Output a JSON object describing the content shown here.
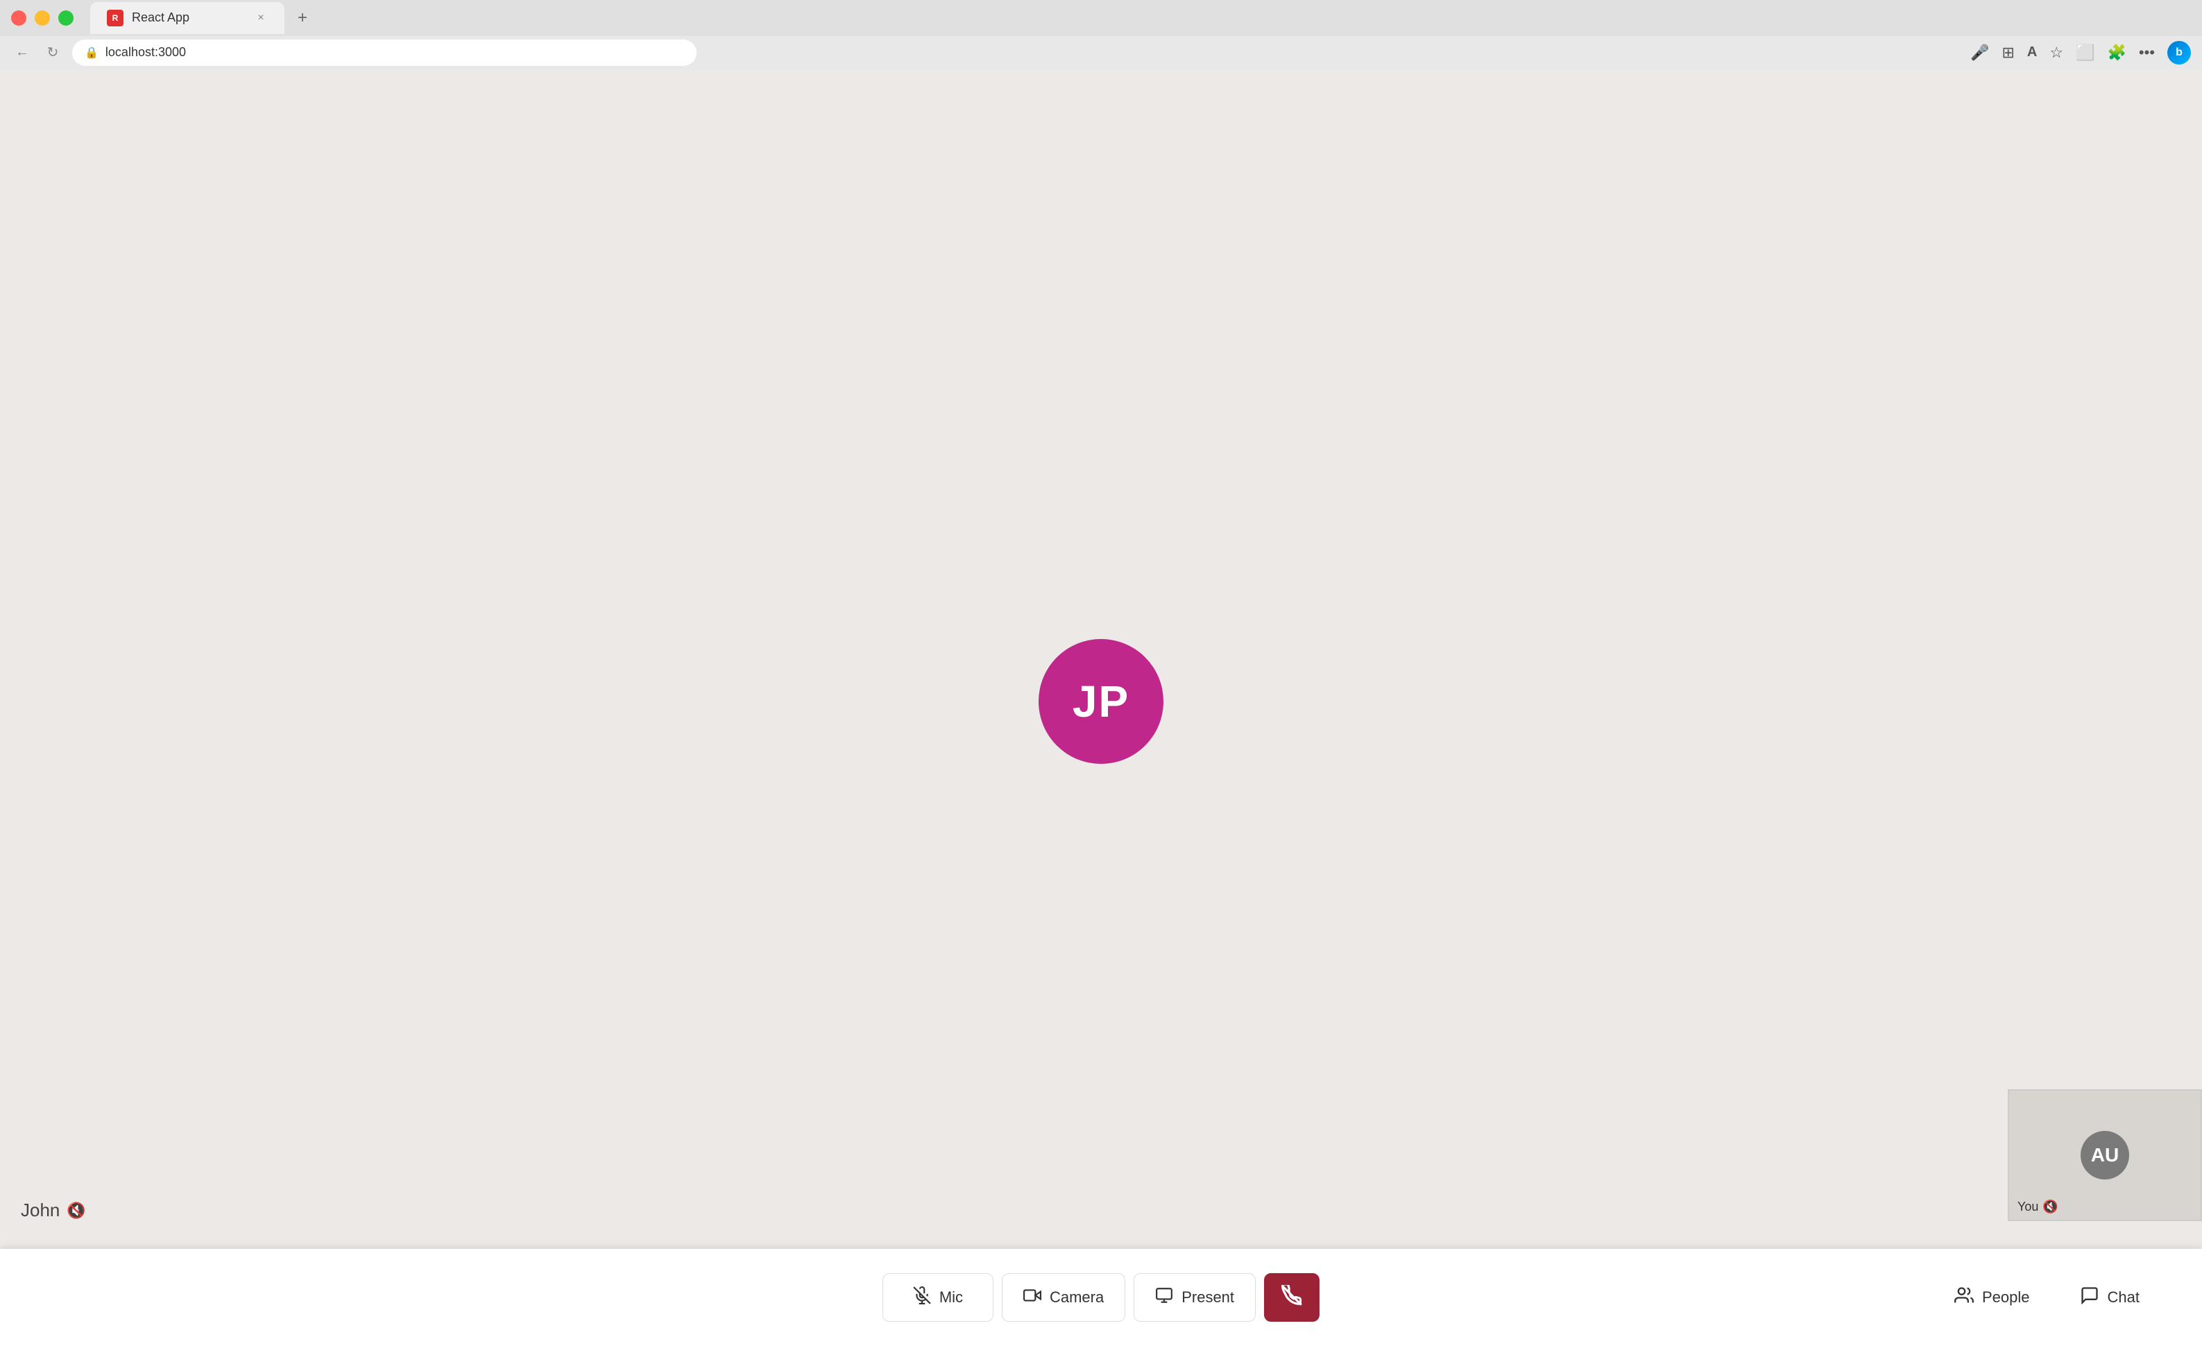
{
  "browser": {
    "tab_title": "React App",
    "favicon_text": "R",
    "url": "localhost:3000",
    "close_label": "×",
    "add_tab_label": "+"
  },
  "call": {
    "main_participant_initials": "JP",
    "main_participant_avatar_color": "#c0278a",
    "john_label": "John",
    "self_initials": "AU",
    "self_label": "You",
    "muted_icon": "🔇"
  },
  "controls": {
    "mic_label": "Mic",
    "camera_label": "Camera",
    "present_label": "Present",
    "end_call_label": "",
    "people_label": "People",
    "chat_label": "Chat"
  },
  "icons": {
    "mic_muted": "mic-slash",
    "camera": "camera",
    "present": "screen-share",
    "end_call": "phone-down",
    "people": "people",
    "chat": "chat-bubble",
    "back": "←",
    "reload": "↻",
    "lock": "🔒",
    "mic_browser": "🎤",
    "grid": "⊞",
    "read_mode": "A",
    "favorites": "☆",
    "split_view": "⬜",
    "extensions": "🧩",
    "more": "…",
    "bing": "b"
  }
}
